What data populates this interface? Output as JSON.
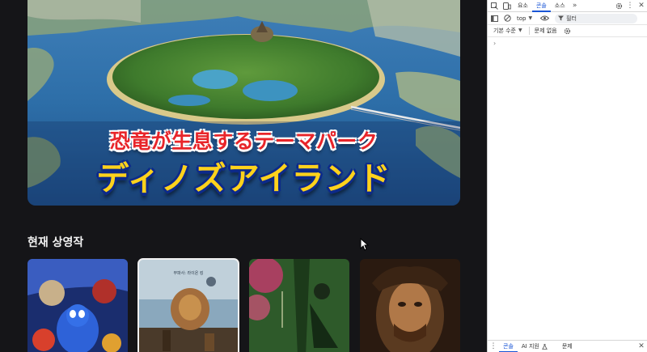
{
  "hero": {
    "line1": "恐竜が生息するテーマパーク",
    "line2": "ディノズアイランド"
  },
  "section": {
    "title": "현재 상영작"
  },
  "posters": [
    {
      "name": "poster-1",
      "palette": [
        "#1a2d6e",
        "#3a6fd8",
        "#d8402c"
      ]
    },
    {
      "name": "poster-2",
      "text": "무파사: 라이온 킹",
      "palette": [
        "#2e4f6e",
        "#8aa8bd",
        "#a36d3c"
      ]
    },
    {
      "name": "poster-3",
      "palette": [
        "#2e5a2a",
        "#c73a6e",
        "#1c3a1a"
      ]
    },
    {
      "name": "poster-4",
      "palette": [
        "#2a1a10",
        "#8a5a30",
        "#d0a070"
      ]
    }
  ],
  "devtools": {
    "tabs": [
      "요소",
      "콘솔",
      "소스"
    ],
    "active_tab": "콘솔",
    "context": "top",
    "filter_placeholder": "필터",
    "levels": "기본 수준",
    "issues": "문제 없음",
    "bottom_tabs": [
      "콘솔",
      "AI 지원",
      "문제"
    ],
    "bottom_active": "콘솔",
    "accent_color": "#1a56d6"
  }
}
